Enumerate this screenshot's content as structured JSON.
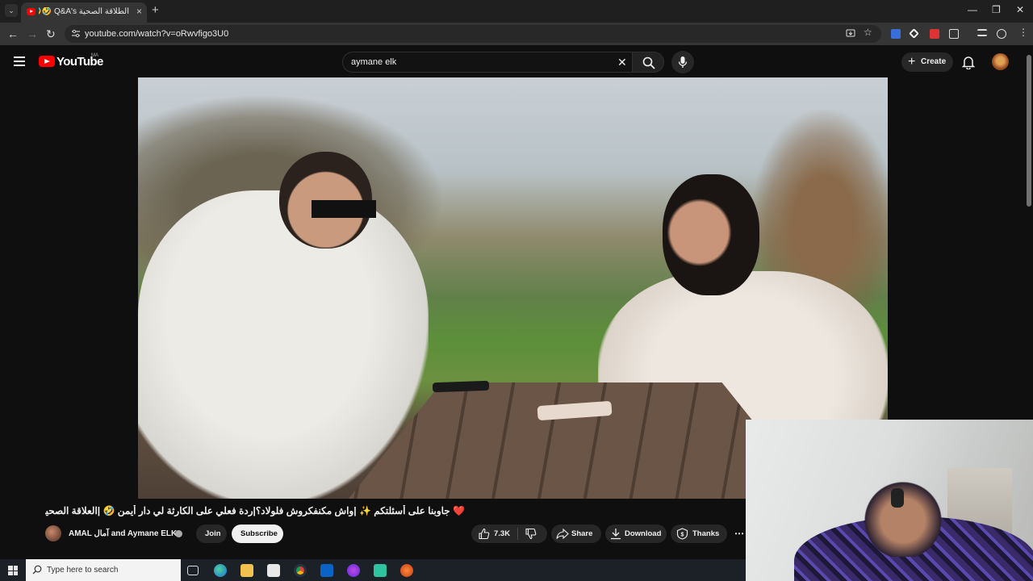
{
  "browser": {
    "tab": {
      "title": "Q&A's العلاقة الصحية ترجمة وإجابات 😂🤣 جاوبنا على أسئلتكم",
      "title_visible": "الطلاقة الصحية Q&A's 🤣🤣",
      "close": "×"
    },
    "new_tab": "+",
    "window_controls": {
      "minimize": "—",
      "restore": "❐",
      "close": "✕"
    },
    "nav": {
      "back": "←",
      "forward": "→",
      "reload": "↻"
    },
    "url": "youtube.com/watch?v=oRwvfigo3U0"
  },
  "youtube": {
    "wordmark": "YouTube",
    "region": "MA",
    "search": {
      "value": "aymane elk",
      "clear": "✕"
    },
    "create_label": "Create",
    "create_plus": "+"
  },
  "video": {
    "title": "❤️ جاوبنا على أسئلتكم ✨ |واش مكنفكروش فلولاد؟|ردة فعلي على الكارثة لي دار أيمن 🤣 |العلاقة الصحية 🤣 |Q&A's"
  },
  "channel": {
    "name": "AMAL آمال and Aymane ELK",
    "join_label": "Join",
    "subscribe_label": "Subscribe"
  },
  "actions": {
    "likes": "7.3K",
    "share": "Share",
    "download": "Download",
    "thanks": "Thanks",
    "more": "⋯"
  },
  "taskbar": {
    "search_placeholder": "Type here to search"
  },
  "colors": {
    "yt_red": "#ff0000",
    "page_bg": "#0f0f0f",
    "pill_bg": "#272727",
    "subscribe_bg": "#f1f1f1",
    "taskbar_bg": "#1c2128"
  },
  "icons": {
    "tab_menu": "chevron-down-icon",
    "favicon": "youtube-favicon-icon",
    "site_info": "tune-icon",
    "install": "install-app-icon",
    "bookmark": "star-icon",
    "hamburger": "menu-icon",
    "search": "search-icon",
    "mic": "microphone-icon",
    "notifications": "bell-icon",
    "like": "thumbs-up-icon",
    "dislike": "thumbs-down-icon",
    "share": "share-arrow-icon",
    "download": "download-icon",
    "thanks": "super-thanks-icon",
    "windows": "windows-logo-icon"
  }
}
